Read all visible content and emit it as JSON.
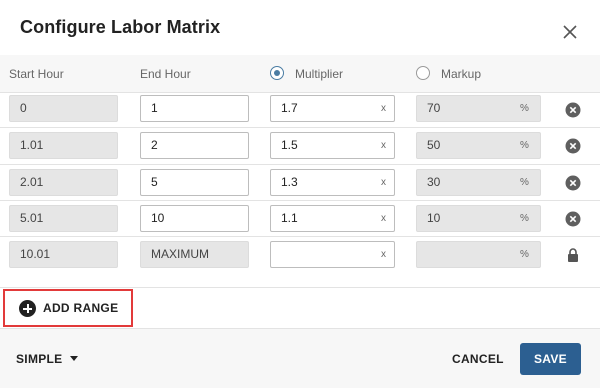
{
  "dialog": {
    "title": "Configure Labor Matrix"
  },
  "columns": {
    "start_hour": "Start Hour",
    "end_hour": "End Hour",
    "multiplier": "Multiplier",
    "markup": "Markup",
    "selected_mode": "multiplier"
  },
  "rows": [
    {
      "start": "0",
      "end": "1",
      "multiplier": "1.7",
      "markup": "70",
      "multiplier_suffix": "x",
      "markup_suffix": "%"
    },
    {
      "start": "1.01",
      "end": "2",
      "multiplier": "1.5",
      "markup": "50",
      "multiplier_suffix": "x",
      "markup_suffix": "%"
    },
    {
      "start": "2.01",
      "end": "5",
      "multiplier": "1.3",
      "markup": "30",
      "multiplier_suffix": "x",
      "markup_suffix": "%"
    },
    {
      "start": "5.01",
      "end": "10",
      "multiplier": "1.1",
      "markup": "10",
      "multiplier_suffix": "x",
      "markup_suffix": "%"
    },
    {
      "start": "10.01",
      "end": "MAXIMUM",
      "multiplier": "",
      "markup": "",
      "multiplier_suffix": "x",
      "markup_suffix": "%"
    }
  ],
  "actions": {
    "add_range": "ADD RANGE",
    "mode_dropdown": "SIMPLE",
    "cancel": "CANCEL",
    "save": "SAVE"
  },
  "colors": {
    "primary": "#2c5f91",
    "radio_selected": "#4a7ca3",
    "highlight_border": "#e23a3a"
  },
  "icons": {
    "close": "close-icon",
    "remove": "remove-circle-icon",
    "lock": "lock-icon",
    "add": "plus-circle-icon",
    "dropdown": "caret-down-icon"
  }
}
